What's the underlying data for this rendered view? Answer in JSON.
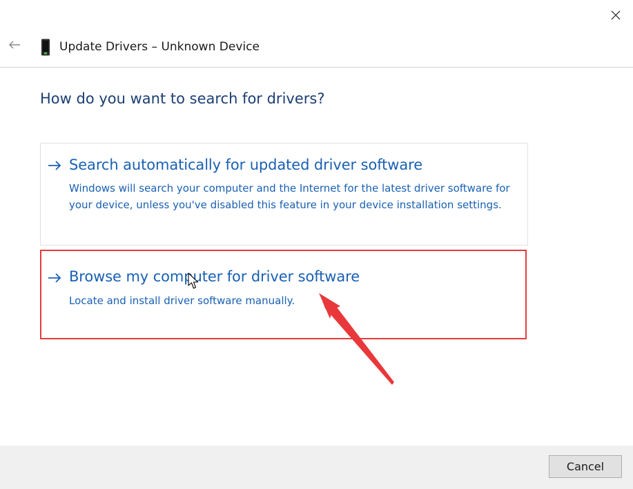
{
  "window": {
    "title": "Update Drivers – Unknown Device",
    "close_icon": "close-icon",
    "back_icon": "back-arrow-icon",
    "device_icon": "device-icon"
  },
  "main": {
    "question": "How do you want to search for drivers?",
    "options": [
      {
        "icon": "right-arrow-icon",
        "title": "Search automatically for updated driver software",
        "description": "Windows will search your computer and the Internet for the latest driver software for your device, unless you've disabled this feature in your device installation settings."
      },
      {
        "icon": "right-arrow-icon",
        "title": "Browse my computer for driver software",
        "description": "Locate and install driver software manually.",
        "highlighted": true
      }
    ]
  },
  "footer": {
    "cancel_label": "Cancel"
  },
  "colors": {
    "link_blue": "#1960b3",
    "heading_blue": "#1b3e72",
    "highlight_red": "#e53a3d",
    "footer_bg": "#f0f0f0"
  }
}
